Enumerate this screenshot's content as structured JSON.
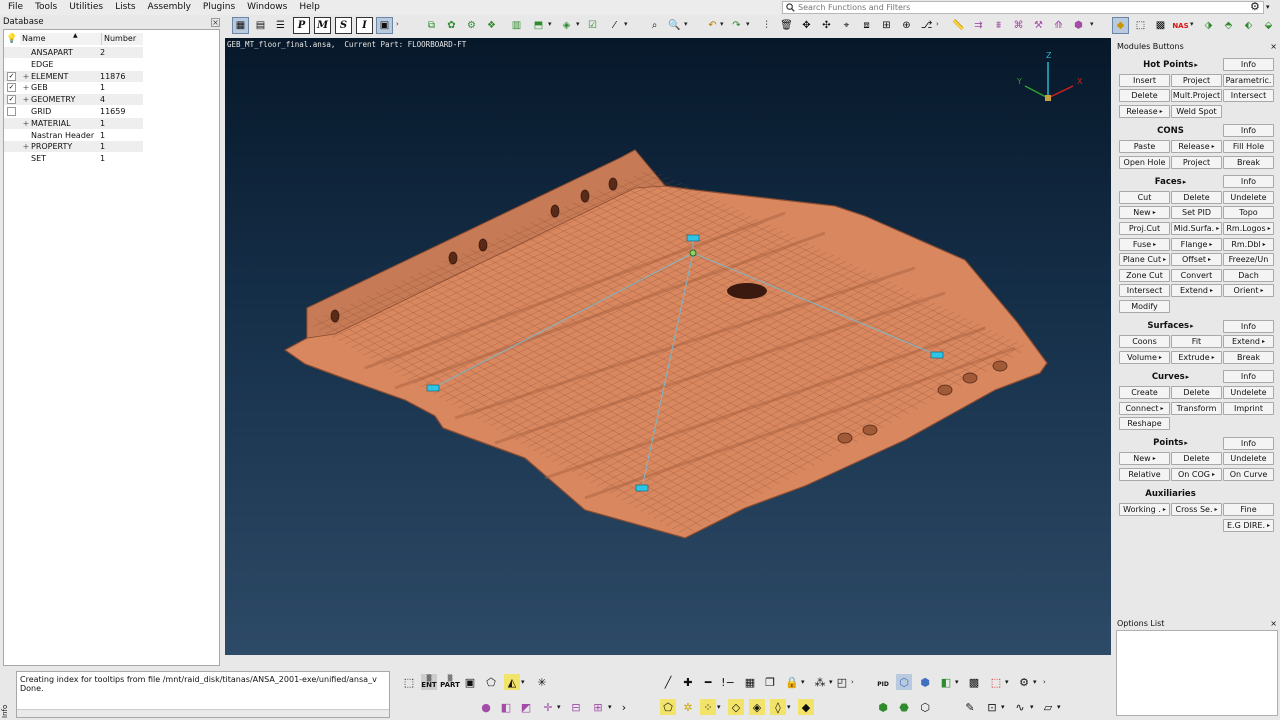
{
  "menu": [
    "File",
    "Tools",
    "Utilities",
    "Lists",
    "Assembly",
    "Plugins",
    "Windows",
    "Help"
  ],
  "search": {
    "placeholder": "Search Functions and Filters"
  },
  "toolbar": {
    "boxed_letters": [
      "P",
      "M",
      "S",
      "I"
    ],
    "nas_label": "NAS"
  },
  "database": {
    "title": "Database",
    "columns": {
      "name": "Name",
      "number": "Number"
    },
    "rows": [
      {
        "name": "ANSAPART",
        "number": "2",
        "checkbox": false,
        "checked": false,
        "expand": false
      },
      {
        "name": "EDGE",
        "number": "",
        "checkbox": false,
        "checked": false,
        "expand": false
      },
      {
        "name": "ELEMENT",
        "number": "11876",
        "checkbox": true,
        "checked": true,
        "expand": true
      },
      {
        "name": "GEB",
        "number": "1",
        "checkbox": true,
        "checked": true,
        "expand": true
      },
      {
        "name": "GEOMETRY",
        "number": "4",
        "checkbox": true,
        "checked": true,
        "expand": true
      },
      {
        "name": "GRID",
        "number": "11659",
        "checkbox": true,
        "checked": false,
        "expand": false
      },
      {
        "name": "MATERIAL",
        "number": "1",
        "checkbox": false,
        "checked": false,
        "expand": true
      },
      {
        "name": "Nastran Header",
        "number": "1",
        "checkbox": false,
        "checked": false,
        "expand": false
      },
      {
        "name": "PROPERTY",
        "number": "1",
        "checkbox": false,
        "checked": false,
        "expand": true
      },
      {
        "name": "SET",
        "number": "1",
        "checkbox": false,
        "checked": false,
        "expand": false
      }
    ]
  },
  "viewport": {
    "info": "GEB_MT_floor_final.ansa,  Current Part: FLOORBOARD-FT",
    "axes": {
      "x": "X",
      "y": "Y",
      "z": "Z"
    },
    "colors": {
      "mesh": "#d8875f",
      "mesh_dark": "#8a4c30",
      "connection": "#7fb6c8",
      "node": "#2ec4e6"
    }
  },
  "modules": {
    "title": "Modules Buttons",
    "sections": [
      {
        "title": "Hot Points",
        "arrow": true,
        "info": "Info",
        "rows": [
          [
            "Insert",
            "Project",
            "Parametric."
          ],
          [
            "Delete",
            "Mult.Project",
            "Intersect"
          ],
          [
            "Release",
            "Weld Spot",
            ""
          ]
        ]
      },
      {
        "title": "CONS",
        "arrow": false,
        "info": "Info",
        "rows": [
          [
            "Paste",
            "Release",
            "Fill Hole"
          ],
          [
            "Open Hole",
            "Project",
            "Break"
          ]
        ]
      },
      {
        "title": "Faces",
        "arrow": true,
        "info": "Info",
        "rows": [
          [
            "Cut",
            "Delete",
            "Undelete"
          ],
          [
            "New",
            "Set PID",
            "Topo"
          ],
          [
            "Proj.Cut",
            "Mid.Surfa.",
            "Rm.Logos"
          ],
          [
            "Fuse",
            "Flange",
            "Rm.Dbl"
          ],
          [
            "Plane Cut",
            "Offset",
            "Freeze/Un"
          ],
          [
            "Zone Cut",
            "Convert",
            "Dach"
          ],
          [
            "Intersect",
            "Extend",
            "Orient"
          ],
          [
            "Modify",
            "",
            ""
          ]
        ]
      },
      {
        "title": "Surfaces",
        "arrow": true,
        "info": "Info",
        "rows": [
          [
            "Coons",
            "Fit",
            "Extend"
          ],
          [
            "Volume",
            "Extrude",
            "Break"
          ]
        ]
      },
      {
        "title": "Curves",
        "arrow": true,
        "info": "Info",
        "rows": [
          [
            "Create",
            "Delete",
            "Undelete"
          ],
          [
            "Connect",
            "Transform",
            "Imprint"
          ],
          [
            "Reshape",
            "",
            ""
          ]
        ]
      },
      {
        "title": "Points",
        "arrow": true,
        "info": "Info",
        "rows": [
          [
            "New",
            "Delete",
            "Undelete"
          ],
          [
            "Relative",
            "On COG",
            "On Curve"
          ]
        ]
      },
      {
        "title": "Auxiliaries",
        "arrow": false,
        "info": "",
        "rows": [
          [
            "Working .",
            "Cross Se.",
            "Fine"
          ],
          [
            "",
            "",
            "E.G DIRE."
          ]
        ]
      }
    ],
    "dropdown_buttons": [
      "Release",
      "Mid.Surfa.",
      "Rm.Logos",
      "Fuse",
      "Flange",
      "Rm.Dbl",
      "Plane Cut",
      "Offset",
      "Extend",
      "Orient",
      "Volume",
      "Extrude",
      "Connect",
      "New",
      "On COG",
      "Working .",
      "Cross Se.",
      "E.G DIRE."
    ]
  },
  "options": {
    "title": "Options List"
  },
  "console": {
    "lines": [
      "Creating index for tooltips from file /mnt/raid_disk/titanas/ANSA_2001-exe/unified/ansa_v",
      "Done."
    ],
    "side_label": "Info"
  },
  "bottom": {
    "ent": "ENT",
    "part": "PART",
    "pid": "PID"
  }
}
